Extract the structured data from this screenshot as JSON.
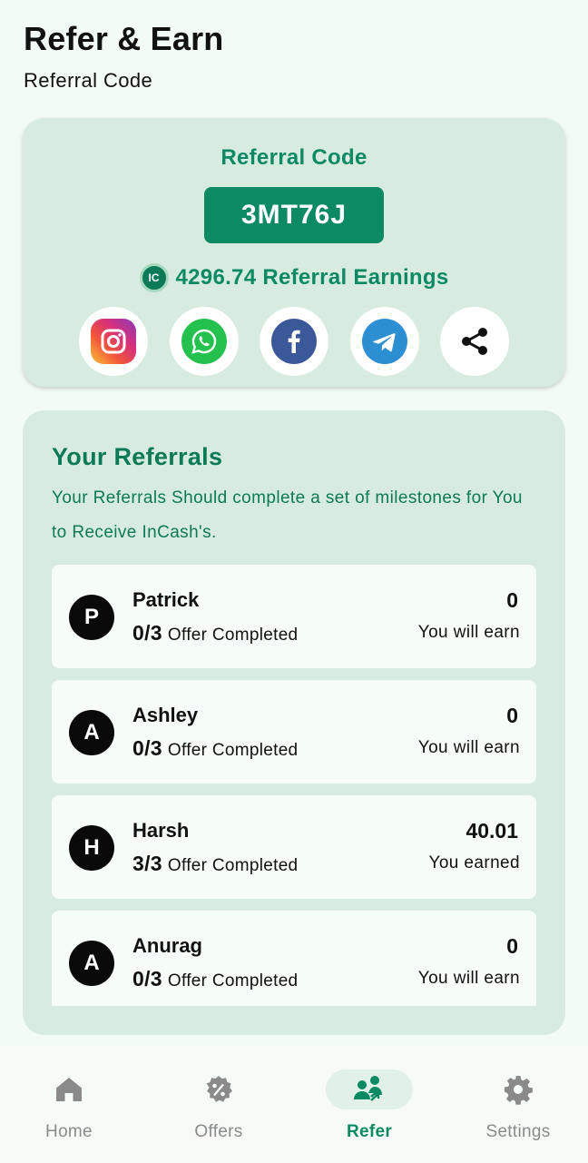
{
  "header": {
    "title": "Refer & Earn",
    "subtitle": "Referral Code"
  },
  "code_card": {
    "title": "Referral Code",
    "code": "3MT76J",
    "coin_label": "IC",
    "earnings": "4296.74 Referral Earnings",
    "share_icons": [
      "instagram-icon",
      "whatsapp-icon",
      "facebook-icon",
      "telegram-icon",
      "share-icon"
    ]
  },
  "referrals": {
    "title": "Your Referrals",
    "description": "Your Referrals Should complete a set of milestones for You to Receive InCash's.",
    "items": [
      {
        "initial": "P",
        "name": "Patrick",
        "count": "0/3",
        "status": "Offer Completed",
        "amount": "0",
        "earn_label": "You will earn"
      },
      {
        "initial": "A",
        "name": "Ashley",
        "count": "0/3",
        "status": "Offer Completed",
        "amount": "0",
        "earn_label": "You will earn"
      },
      {
        "initial": "H",
        "name": "Harsh",
        "count": "3/3",
        "status": "Offer Completed",
        "amount": "40.01",
        "earn_label": "You earned"
      },
      {
        "initial": "A",
        "name": "Anurag",
        "count": "0/3",
        "status": "Offer Completed",
        "amount": "0",
        "earn_label": "You will earn"
      }
    ]
  },
  "nav": {
    "items": [
      {
        "label": "Home",
        "icon": "home-icon"
      },
      {
        "label": "Offers",
        "icon": "offers-icon"
      },
      {
        "label": "Refer",
        "icon": "refer-icon",
        "active": true
      },
      {
        "label": "Settings",
        "icon": "gear-icon"
      }
    ]
  },
  "colors": {
    "accent": "#0b8a63",
    "card_bg": "#d8ebe0",
    "page_bg": "#f3fbf6"
  }
}
